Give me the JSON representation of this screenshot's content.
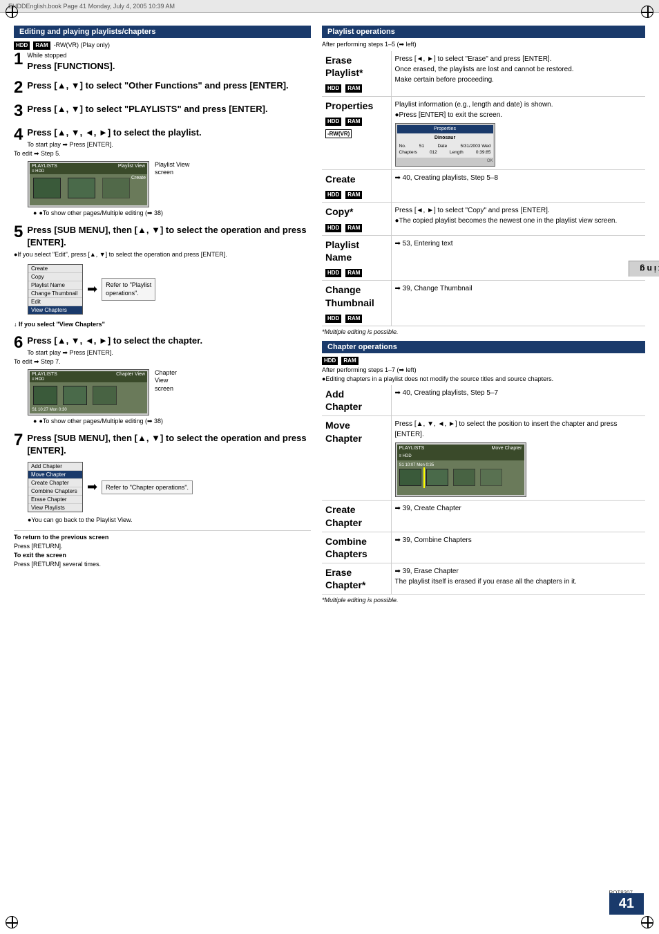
{
  "page": {
    "title": "Editing and playing playlists/chapters",
    "book_info": "EHDDEnglish.book   Page 41   Monday, July 4, 2005   10:39 AM",
    "page_number": "41",
    "rqt_number": "RQT8307",
    "editing_tab": "Editing"
  },
  "left": {
    "section_title": "Editing and playing playlists/chapters",
    "badges": [
      "HDD",
      "RAM"
    ],
    "play_only_label": "-RW(VR) (Play only)",
    "steps": [
      {
        "num": "1",
        "sub_label": "While stopped",
        "text_bold": "Press [FUNCTIONS]."
      },
      {
        "num": "2",
        "text_bold": "Press [▲, ▼] to select \"Other Functions\" and press [ENTER]."
      },
      {
        "num": "3",
        "text_bold": "Press [▲, ▼] to select \"PLAYLISTS\" and press [ENTER]."
      },
      {
        "num": "4",
        "text_bold": "Press [▲, ▼, ◄, ►] to select the playlist.",
        "sub_lines": [
          "To start play ➡ Press [ENTER].",
          "To edit ➡ Step 5."
        ],
        "screen_label": "Playlist View screen",
        "screen_title_left": "PLAYLISTS",
        "screen_title_right": "Playlist View",
        "screen_sub": "≡ HDD",
        "bullet": "●To show other pages/Multiple editing (➡ 38)"
      },
      {
        "num": "5",
        "text_bold": "Press [SUB MENU], then [▲, ▼] to select the operation and press [ENTER].",
        "bullet": "●If you select \"Edit\", press [▲, ▼] to select the operation and press [ENTER].",
        "menu_items": [
          "Create",
          "Copy",
          "Playlist Name",
          "Change Thumbnail",
          "Edit",
          "View Chapters"
        ],
        "menu_highlighted": "View Chapters",
        "refer_label": "Refer to \"Playlist operations\".",
        "if_view_chapters": "If you select \"View Chapters\""
      },
      {
        "num": "6",
        "text_bold": "Press [▲, ▼, ◄, ►] to select the chapter.",
        "sub_lines": [
          "To start play ➡ Press [ENTER].",
          "To edit ➡ Step 7."
        ],
        "screen_label": "Chapter View screen",
        "screen_title_left": "PLAYLISTS",
        "screen_title_right": "Chapter View",
        "screen_sub": "≡ HDD",
        "bullet": "●To show other pages/Multiple editing (➡ 38)"
      },
      {
        "num": "7",
        "text_bold": "Press [SUB MENU], then [▲, ▼] to select the operation and press [ENTER].",
        "menu_items": [
          "Add Chapter",
          "Move Chapter",
          "Create Chapter",
          "Combine Chapters",
          "Erase Chapter",
          "View Playlists"
        ],
        "menu_highlighted": "",
        "refer_label": "Refer to \"Chapter operations\".",
        "bullet": "●You can go back to the Playlist View."
      }
    ],
    "bottom_notes": [
      {
        "label": "To return to the previous screen",
        "text": "Press [RETURN]."
      },
      {
        "label": "To exit the screen",
        "text": "Press [RETURN] several times."
      }
    ]
  },
  "right": {
    "playlist_ops": {
      "title": "Playlist operations",
      "intro": "After performing steps 1–5 (➡ left)",
      "operations": [
        {
          "name": "Erase Playlist*",
          "badges": [
            "HDD",
            "RAM"
          ],
          "desc": "Press [◄, ►] to select \"Erase\" and press [ENTER].\nOnce erased, the playlists are lost and cannot be restored.\nMake certain before proceeding."
        },
        {
          "name": "Properties",
          "badges": [
            "HDD",
            "RAM",
            "-RW(VR)"
          ],
          "desc": "Playlist information (e.g., length and date) is shown.\n●Press [ENTER] to exit the screen.",
          "has_screen": true,
          "screen_title": "Properties",
          "screen_sub_title": "Dinosaur",
          "screen_rows": [
            {
              "label": "No.",
              "val": "51",
              "label2": "Date",
              "val2": "5/31/2003 Wed"
            },
            {
              "label": "Chapters",
              "val": "012",
              "label2": "Length",
              "val2": "0:39:85"
            }
          ]
        },
        {
          "name": "Create",
          "badges": [
            "HDD",
            "RAM"
          ],
          "desc": "➡ 40, Creating playlists, Step 5–8"
        },
        {
          "name": "Copy*",
          "badges": [
            "HDD",
            "RAM"
          ],
          "desc": "Press [◄, ►] to select \"Copy\" and press [ENTER].\n●The copied playlist becomes the newest one in the playlist view screen."
        },
        {
          "name": "Playlist Name",
          "badges": [
            "HDD",
            "RAM"
          ],
          "desc": "➡ 53, Entering text"
        },
        {
          "name": "Change Thumbnail",
          "badges": [
            "HDD",
            "RAM"
          ],
          "desc": "➡ 39, Change Thumbnail"
        }
      ],
      "footnote": "*Multiple editing is possible."
    },
    "chapter_ops": {
      "title": "Chapter operations",
      "badges": [
        "HDD",
        "RAM"
      ],
      "intro": "After performing steps 1–7 (➡ left)",
      "note": "●Editing chapters in a playlist does not modify the source titles and source chapters.",
      "operations": [
        {
          "name": "Add Chapter",
          "desc": "➡ 40, Creating playlists, Step 5–7"
        },
        {
          "name": "Move Chapter",
          "desc": "Press [▲, ▼, ◄, ►] to select the position to insert the chapter and press [ENTER].",
          "has_screen": true,
          "screen_title_left": "PLAYLISTS",
          "screen_title_right": "Move Chapter",
          "screen_sub": "≡ HDD",
          "screen_time": "S1 10:07 Mon 0:35"
        },
        {
          "name": "Create Chapter",
          "desc": "➡ 39, Create Chapter"
        },
        {
          "name": "Combine Chapters",
          "desc": "➡ 39, Combine Chapters"
        },
        {
          "name": "Erase Chapter*",
          "desc": "➡ 39, Erase Chapter\nThe playlist itself is erased if you erase all the chapters in it."
        }
      ],
      "footnote": "*Multiple editing is possible."
    }
  }
}
